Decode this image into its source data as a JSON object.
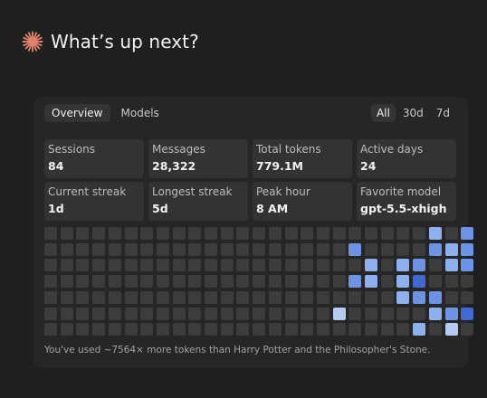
{
  "header": {
    "title": "What’s up next?",
    "icon": "sparkle-icon",
    "icon_color": "#e0836a"
  },
  "tabs": [
    {
      "label": "Overview",
      "active": true
    },
    {
      "label": "Models",
      "active": false
    }
  ],
  "ranges": [
    {
      "label": "All",
      "active": true
    },
    {
      "label": "30d",
      "active": false
    },
    {
      "label": "7d",
      "active": false
    }
  ],
  "stats": [
    {
      "label": "Sessions",
      "value": "84"
    },
    {
      "label": "Messages",
      "value": "28,322"
    },
    {
      "label": "Total tokens",
      "value": "779.1M"
    },
    {
      "label": "Active days",
      "value": "24"
    },
    {
      "label": "Current streak",
      "value": "1d"
    },
    {
      "label": "Longest streak",
      "value": "5d"
    },
    {
      "label": "Peak hour",
      "value": "8 AM"
    },
    {
      "label": "Favorite model",
      "value": "gpt-5.5-xhigh"
    }
  ],
  "heatmap": {
    "colors": [
      "#3c3c3c",
      "#b7cbf2",
      "#8fb0ee",
      "#6d93e4",
      "#3f6bd0"
    ],
    "levels": [
      [
        0,
        0,
        0,
        0,
        0,
        0,
        0,
        0,
        0,
        0,
        0,
        0,
        0,
        0,
        0,
        0,
        0,
        0,
        0,
        0,
        0,
        0,
        0,
        0,
        2,
        0,
        3
      ],
      [
        0,
        0,
        0,
        0,
        0,
        0,
        0,
        0,
        0,
        0,
        0,
        0,
        0,
        0,
        0,
        0,
        0,
        0,
        0,
        3,
        0,
        0,
        0,
        0,
        3,
        2,
        3
      ],
      [
        0,
        0,
        0,
        0,
        0,
        0,
        0,
        0,
        0,
        0,
        0,
        0,
        0,
        0,
        0,
        0,
        0,
        0,
        0,
        0,
        2,
        0,
        2,
        3,
        0,
        2,
        3
      ],
      [
        0,
        0,
        0,
        0,
        0,
        0,
        0,
        0,
        0,
        0,
        0,
        0,
        0,
        0,
        0,
        0,
        0,
        0,
        0,
        3,
        2,
        0,
        2,
        4,
        0,
        0,
        0
      ],
      [
        0,
        0,
        0,
        0,
        0,
        0,
        0,
        0,
        0,
        0,
        0,
        0,
        0,
        0,
        0,
        0,
        0,
        0,
        0,
        0,
        0,
        0,
        2,
        3,
        3,
        0,
        0
      ],
      [
        0,
        0,
        0,
        0,
        0,
        0,
        0,
        0,
        0,
        0,
        0,
        0,
        0,
        0,
        0,
        0,
        0,
        0,
        1,
        0,
        0,
        0,
        0,
        0,
        2,
        3,
        4
      ],
      [
        0,
        0,
        0,
        0,
        0,
        0,
        0,
        0,
        0,
        0,
        0,
        0,
        0,
        0,
        0,
        0,
        0,
        0,
        0,
        0,
        0,
        0,
        0,
        2,
        0,
        1,
        0
      ]
    ]
  },
  "footnote": "You've used ~7564× more tokens than Harry Potter and the Philosopher's Stone."
}
